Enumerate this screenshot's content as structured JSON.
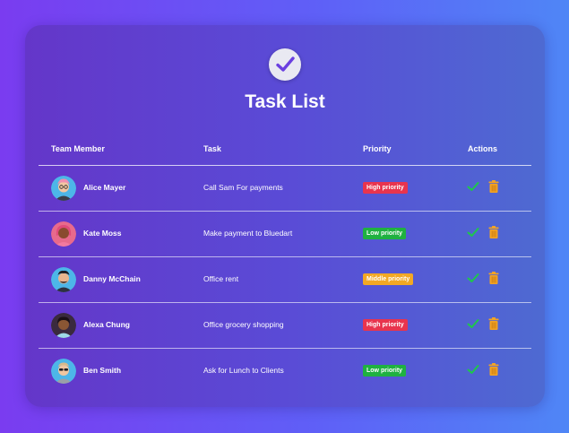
{
  "app": {
    "title": "Task List"
  },
  "table": {
    "headers": {
      "member": "Team Member",
      "task": "Task",
      "priority": "Priority",
      "actions": "Actions"
    },
    "rows": [
      {
        "member": "Alice Mayer",
        "task": "Call Sam For payments",
        "priority": "High priority",
        "priority_color": "#e8344e",
        "avatar_bg": "#4db6e8"
      },
      {
        "member": "Kate Moss",
        "task": "Make payment to Bluedart",
        "priority": "Low priority",
        "priority_color": "#1fb141",
        "avatar_bg": "#e86a8c"
      },
      {
        "member": "Danny McChain",
        "task": "Office rent",
        "priority": "Middle priority",
        "priority_color": "#f2a824",
        "avatar_bg": "#4db6e8"
      },
      {
        "member": "Alexa Chung",
        "task": "Office grocery shopping",
        "priority": "High priority",
        "priority_color": "#e8344e",
        "avatar_bg": "#3a2a3e"
      },
      {
        "member": "Ben Smith",
        "task": "Ask for Lunch to Clients",
        "priority": "Low priority",
        "priority_color": "#1fb141",
        "avatar_bg": "#4db6e8"
      }
    ]
  },
  "icons": {
    "logo": "check-circle-icon",
    "complete": "check-icon",
    "delete": "trash-icon"
  },
  "colors": {
    "check": "#1ec84a",
    "trash": "#f2a324",
    "logo_check": "#6a3fe0"
  }
}
